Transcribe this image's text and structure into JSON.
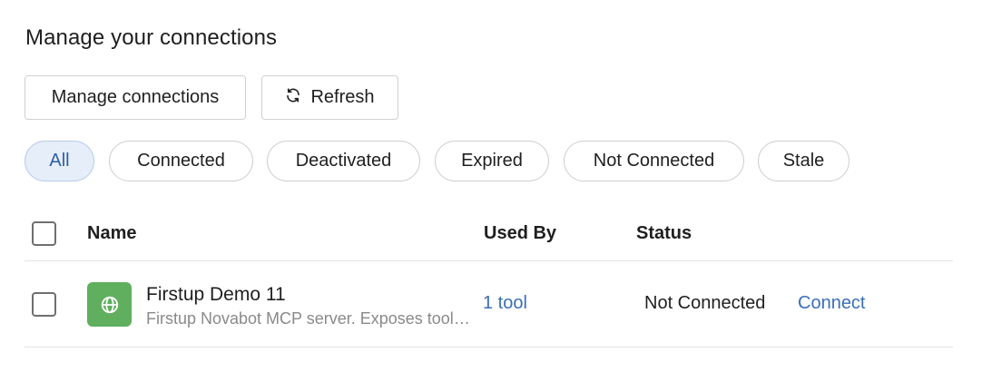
{
  "page": {
    "title": "Manage your connections"
  },
  "toolbar": {
    "manage_label": "Manage connections",
    "refresh_label": "Refresh"
  },
  "filters": [
    {
      "label": "All",
      "active": true
    },
    {
      "label": "Connected",
      "active": false
    },
    {
      "label": "Deactivated",
      "active": false
    },
    {
      "label": "Expired",
      "active": false
    },
    {
      "label": "Not Connected",
      "active": false
    },
    {
      "label": "Stale",
      "active": false
    }
  ],
  "table": {
    "headers": {
      "name": "Name",
      "used_by": "Used By",
      "status": "Status"
    },
    "rows": [
      {
        "name": "Firstup Demo 11",
        "description": "Firstup Novabot MCP server. Exposes tools for searching and retrieving content",
        "icon": "globe-icon",
        "used_by": "1 tool",
        "status": "Not Connected",
        "action": "Connect"
      }
    ]
  },
  "colors": {
    "accent": "#3a6fb7",
    "active_chip_bg": "#e6eef9",
    "app_icon_bg": "#5faf5f"
  }
}
